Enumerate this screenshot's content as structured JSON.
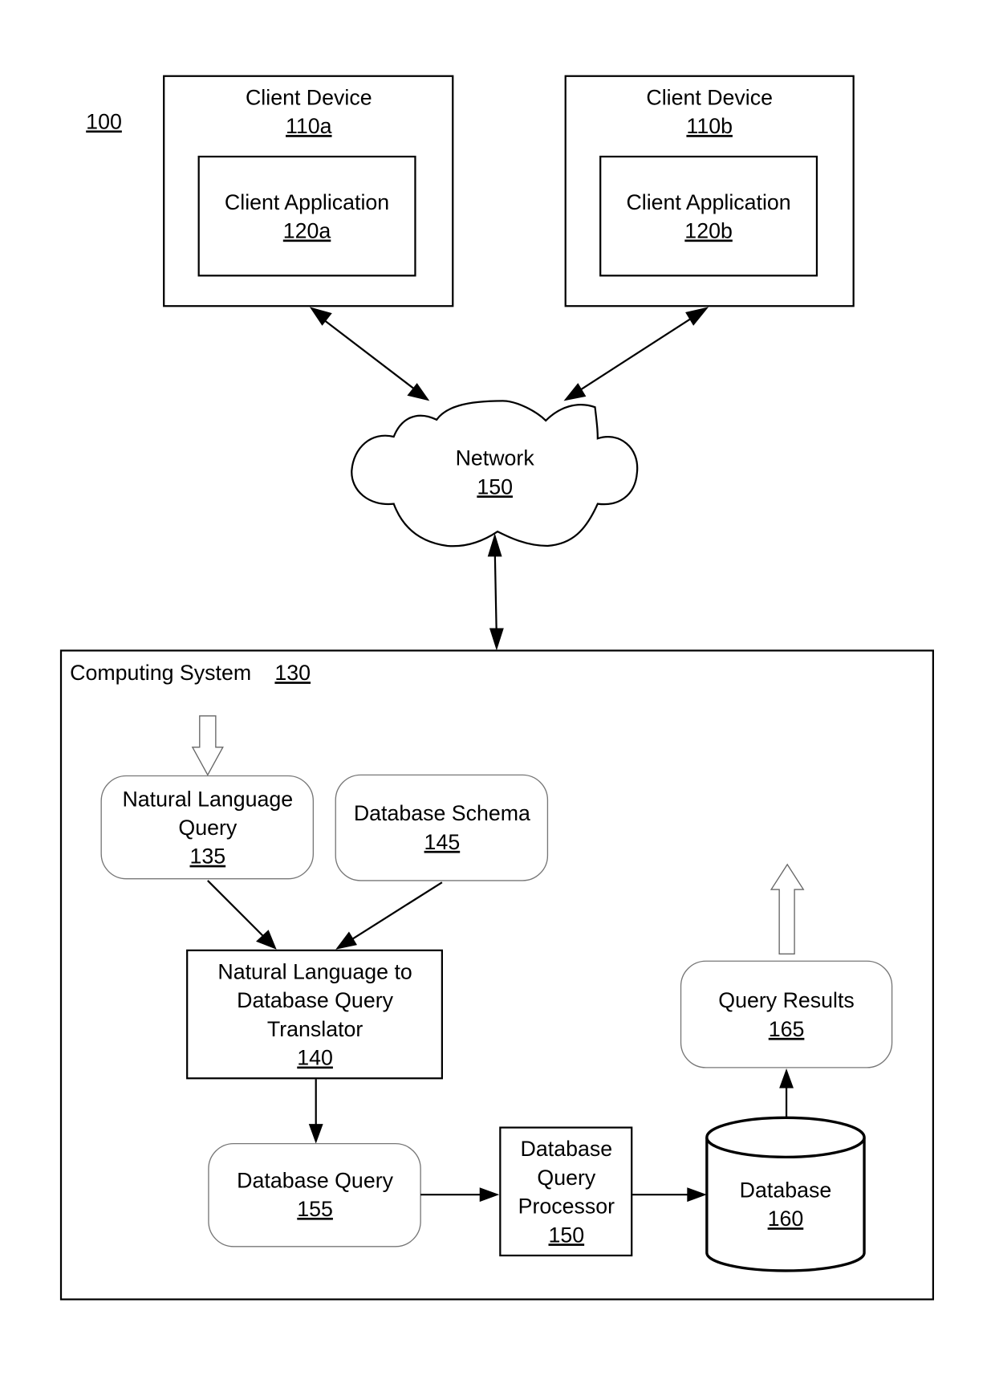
{
  "figure": {
    "ref": "100"
  },
  "client_device_a": {
    "title": "Client Device",
    "ref": "110a",
    "app": {
      "title": "Client Application",
      "ref": "120a"
    }
  },
  "client_device_b": {
    "title": "Client Device",
    "ref": "110b",
    "app": {
      "title": "Client Application",
      "ref": "120b"
    }
  },
  "network": {
    "title": "Network",
    "ref": "150"
  },
  "computing_system": {
    "title": "Computing System",
    "ref": "130"
  },
  "nl_query": {
    "line1": "Natural Language",
    "line2": "Query",
    "ref": "135"
  },
  "db_schema": {
    "title": "Database Schema",
    "ref": "145"
  },
  "translator": {
    "line1": "Natural Language to",
    "line2": "Database Query",
    "line3": "Translator",
    "ref": "140"
  },
  "db_query": {
    "title": "Database Query",
    "ref": "155"
  },
  "query_processor": {
    "line1": "Database",
    "line2": "Query",
    "line3": "Processor",
    "ref": "150"
  },
  "database": {
    "title": "Database",
    "ref": "160"
  },
  "query_results": {
    "title": "Query Results",
    "ref": "165"
  }
}
